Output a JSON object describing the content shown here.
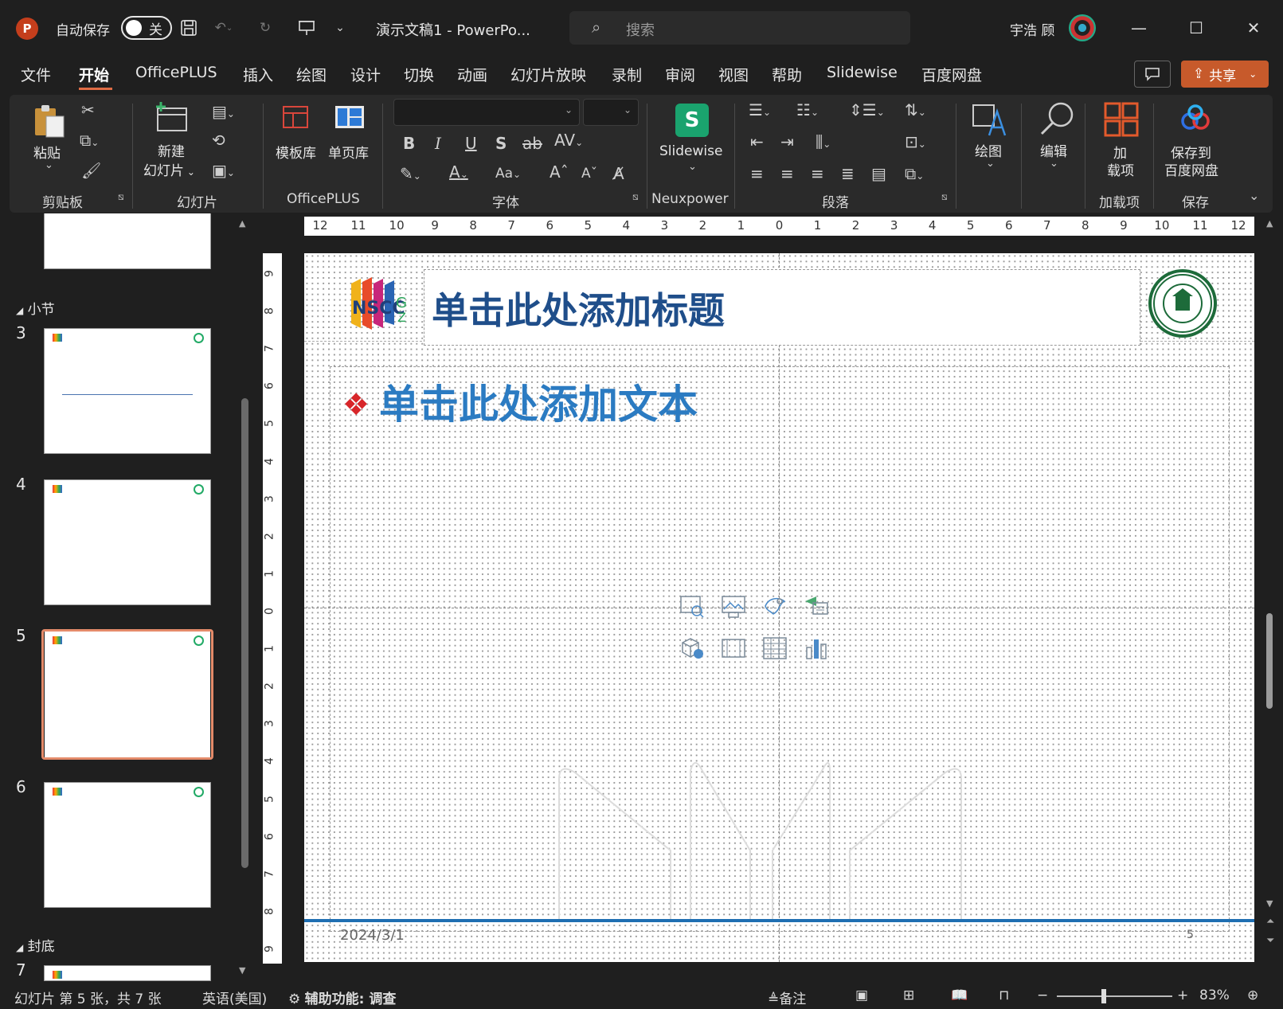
{
  "titlebar": {
    "app_logo": "P",
    "autosave_label": "自动保存",
    "autosave_state": "关",
    "doc_title": "演示文稿1  -  PowerPo...",
    "search_placeholder": "搜索",
    "user_name": "宇浩 顾",
    "icons": [
      "save-icon",
      "undo-icon",
      "redo-icon",
      "present-from-start-icon",
      "customize-qat-icon"
    ]
  },
  "menu": {
    "items": [
      "文件",
      "开始",
      "OfficePLUS",
      "插入",
      "绘图",
      "设计",
      "切换",
      "动画",
      "幻灯片放映",
      "录制",
      "审阅",
      "视图",
      "帮助",
      "Slidewise",
      "百度网盘"
    ],
    "active": "开始",
    "share_label": "共享"
  },
  "ribbon": {
    "clipboard": {
      "paste": "粘贴",
      "group": "剪贴板"
    },
    "slides": {
      "new_slide": "新建",
      "new_slide2": "幻灯片",
      "group": "幻灯片"
    },
    "officeplus": {
      "template_lib": "模板库",
      "single_page_lib": "单页库",
      "group": "OfficePLUS"
    },
    "font": {
      "group": "字体",
      "bold": "B",
      "italic": "I",
      "underline": "U",
      "shadow": "S",
      "strike": "ab",
      "spacing": "AV",
      "case": "Aa",
      "grow": "A",
      "shrink": "A"
    },
    "slidewise": {
      "label": "Slidewise",
      "logo": "S",
      "group": "Neuxpower"
    },
    "paragraph": {
      "group": "段落"
    },
    "drawing": {
      "label": "绘图"
    },
    "editing": {
      "label": "编辑"
    },
    "addins": {
      "label1": "加",
      "label2": "载项",
      "group": "加载项"
    },
    "baidu": {
      "label1": "保存到",
      "label2": "百度网盘",
      "group": "保存"
    }
  },
  "thumbnails": {
    "sections": [
      {
        "label": "小节"
      },
      {
        "label": "封底"
      }
    ],
    "slides": [
      {
        "num": "3"
      },
      {
        "num": "4"
      },
      {
        "num": "5"
      },
      {
        "num": "6"
      },
      {
        "num": "7"
      }
    ],
    "selected": "5"
  },
  "ruler": {
    "h_ticks": [
      "12",
      "11",
      "10",
      "9",
      "8",
      "7",
      "6",
      "5",
      "4",
      "3",
      "2",
      "1",
      "0",
      "1",
      "2",
      "3",
      "4",
      "5",
      "6",
      "7",
      "8",
      "9",
      "10",
      "11",
      "12"
    ],
    "v_ticks": [
      "9",
      "8",
      "7",
      "6",
      "5",
      "4",
      "3",
      "2",
      "1",
      "0",
      "1",
      "2",
      "3",
      "4",
      "5",
      "6",
      "7",
      "8",
      "9"
    ]
  },
  "slide": {
    "title_placeholder": "单击此处添加标题",
    "body_placeholder": "单击此处添加文本",
    "logo_left_text": "NSCC GZ",
    "logo_right_text": "SUN YAT-SEN UNIVERSITY",
    "date": "2024/3/1",
    "page": "5",
    "insert_icons": [
      "stock-images-icon",
      "pictures-icon",
      "icons-insert-icon",
      "smartart-icon",
      "3d-models-icon",
      "video-icon",
      "table-icon",
      "chart-icon"
    ]
  },
  "status": {
    "slide_info": "幻灯片 第 5 张，共 7 张",
    "language": "英语(美国)",
    "accessibility": "辅助功能: 调查",
    "notes": "备注",
    "zoom": "83%"
  }
}
